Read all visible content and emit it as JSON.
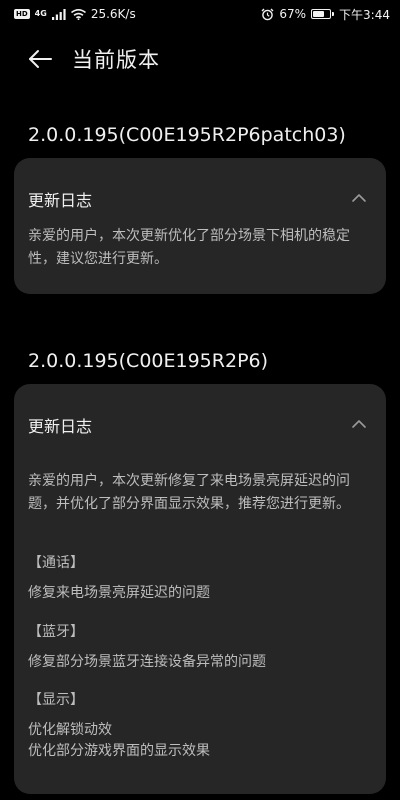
{
  "status_bar": {
    "hd": "HD",
    "network": "4G",
    "speed": "25.6K/s",
    "battery_percent": "67%",
    "battery_level": 0.67,
    "time": "下午3:44",
    "icons": [
      "signal-icon",
      "wifi-icon",
      "alarm-icon",
      "battery-icon"
    ]
  },
  "header": {
    "title": "当前版本",
    "back_icon": "back-arrow-icon"
  },
  "updates": [
    {
      "version": "2.0.0.195(C00E195R2P6patch03)",
      "log_title": "更新日志",
      "expanded": true,
      "intro": "亲爱的用户，本次更新优化了部分场景下相机的稳定性，建议您进行更新。",
      "sections": []
    },
    {
      "version": "2.0.0.195(C00E195R2P6)",
      "log_title": "更新日志",
      "expanded": true,
      "intro": "亲爱的用户，本次更新修复了来电场景亮屏延迟的问题，并优化了部分界面显示效果，推荐您进行更新。",
      "sections": [
        {
          "heading": "【通话】",
          "items": [
            "修复来电场景亮屏延迟的问题"
          ]
        },
        {
          "heading": "【蓝牙】",
          "items": [
            "修复部分场景蓝牙连接设备异常的问题"
          ]
        },
        {
          "heading": "【显示】",
          "items": [
            "优化解锁动效",
            "优化部分游戏界面的显示效果"
          ]
        }
      ]
    }
  ],
  "colors": {
    "background": "#000000",
    "card": "#262626",
    "text_primary": "#f0f0f0",
    "text_secondary": "#bdbdbd"
  }
}
